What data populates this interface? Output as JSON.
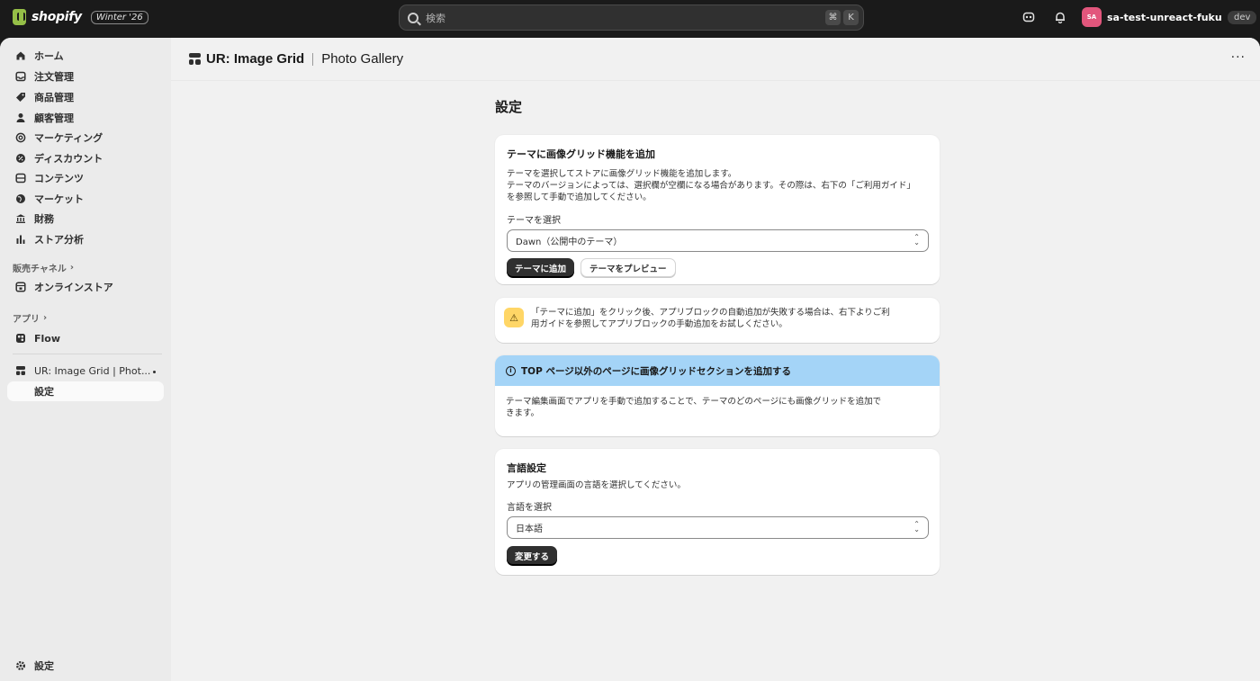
{
  "topbar": {
    "brand": "shopify",
    "edition": "Winter '26",
    "search_placeholder": "検索",
    "kbd_cmd": "⌘",
    "kbd_k": "K",
    "store_initials": "SA",
    "store_name": "sa-test-unreact-fukumot...",
    "env_badge": "dev"
  },
  "sidebar": {
    "items": [
      {
        "label": "ホーム",
        "icon": "home-icon"
      },
      {
        "label": "注文管理",
        "icon": "inbox-icon"
      },
      {
        "label": "商品管理",
        "icon": "tag-icon"
      },
      {
        "label": "顧客管理",
        "icon": "person-icon"
      },
      {
        "label": "マーケティング",
        "icon": "target-icon"
      },
      {
        "label": "ディスカウント",
        "icon": "discount-icon"
      },
      {
        "label": "コンテンツ",
        "icon": "content-icon"
      },
      {
        "label": "マーケット",
        "icon": "globe-icon"
      },
      {
        "label": "財務",
        "icon": "bank-icon"
      },
      {
        "label": "ストア分析",
        "icon": "chart-bar-icon"
      }
    ],
    "sales_channels_heading": "販売チャネル",
    "online_store": "オンラインストア",
    "apps_heading": "アプリ",
    "flow": "Flow",
    "app_name": "UR: Image Grid | Phot...",
    "app_sub_settings": "設定",
    "settings": "設定"
  },
  "header": {
    "app_title": "UR: Image Grid",
    "app_subtitle": "Photo Gallery",
    "more": "···"
  },
  "main": {
    "page_title": "設定",
    "theme_card": {
      "title": "テーマに画像グリッド機能を追加",
      "desc_line1": "テーマを選択してストアに画像グリッド機能を追加します。",
      "desc_line2": "テーマのバージョンによっては、選択欄が空欄になる場合があります。その際は、右下の「ご利用ガイド」",
      "desc_line3": "を参照して手動で追加してください。",
      "select_label": "テーマを選択",
      "select_value": "Dawn（公開中のテーマ）",
      "add_button": "テーマに追加",
      "preview_button": "テーマをプレビュー"
    },
    "warning": {
      "line1": "「テーマに追加」をクリック後、アプリブロックの自動追加が失敗する場合は、右下よりご利",
      "line2": "用ガイドを参照してアプリブロックの手動追加をお試しください。"
    },
    "info_card": {
      "heading": "TOP ページ以外のページに画像グリッドセクションを追加する",
      "line1": "テーマ編集画面でアプリを手動で追加することで、テーマのどのページにも画像グリッドを追加で",
      "line2": "きます。"
    },
    "language_card": {
      "title": "言語設定",
      "desc": "アプリの管理画面の言語を選択してください。",
      "select_label": "言語を選択",
      "select_value": "日本語",
      "change_button": "変更する"
    }
  }
}
